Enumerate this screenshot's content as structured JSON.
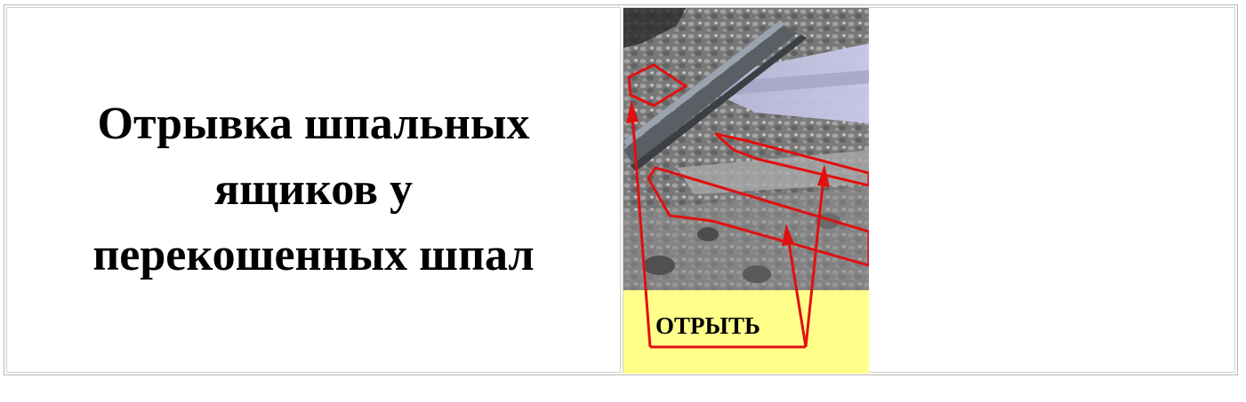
{
  "heading": {
    "line1": "Отрывка шпальных",
    "line2": "ящиков у",
    "line3": "перекошенных шпал"
  },
  "illustration": {
    "caption": "ОТРЫТЬ",
    "subject": "railway track photo with sleeper boxes outlined and red arrows",
    "colors": {
      "caption_background": "#ffff8a",
      "annotation": "#e01010"
    }
  }
}
